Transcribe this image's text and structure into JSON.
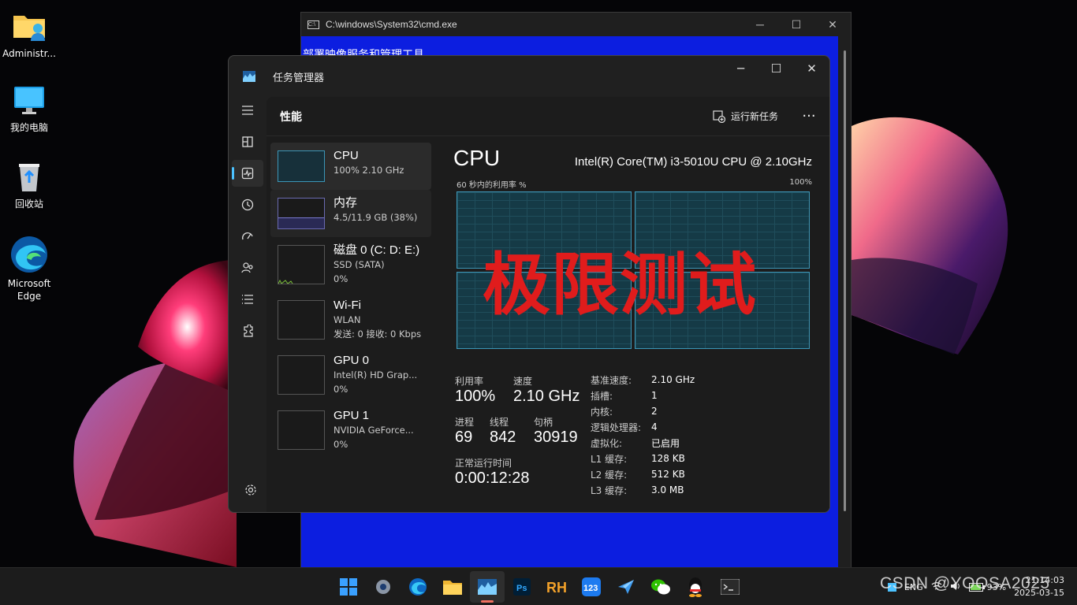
{
  "desktop": {
    "icons": [
      {
        "label": "Administr...",
        "icon": "user-folder-icon"
      },
      {
        "label": "我的电脑",
        "icon": "computer-icon"
      },
      {
        "label": "回收站",
        "icon": "recycle-bin-icon"
      },
      {
        "label": "Microsoft Edge",
        "icon": "edge-icon"
      }
    ]
  },
  "cmd": {
    "title": "C:\\windows\\System32\\cmd.exe",
    "body_text": "部署映像服务和管理工具"
  },
  "taskmgr": {
    "title": "任务管理器",
    "page_title": "性能",
    "run_task_label": "运行新任务",
    "more_label": "···",
    "sidebar": [
      "menu-icon",
      "processes-icon",
      "performance-icon",
      "app-history-icon",
      "startup-icon",
      "users-icon",
      "details-icon",
      "services-icon",
      "settings-icon"
    ],
    "perf_items": [
      {
        "name": "CPU",
        "line1": "100% 2.10 GHz",
        "line2": ""
      },
      {
        "name": "内存",
        "line1": "4.5/11.9 GB (38%)",
        "line2": ""
      },
      {
        "name": "磁盘 0 (C: D: E:)",
        "line1": "SSD (SATA)",
        "line2": "0%"
      },
      {
        "name": "Wi-Fi",
        "line1": "WLAN",
        "line2": "发送: 0 接收: 0 Kbps"
      },
      {
        "name": "GPU 0",
        "line1": "Intel(R) HD Grap...",
        "line2": "0%"
      },
      {
        "name": "GPU 1",
        "line1": "NVIDIA GeForce...",
        "line2": "0%"
      }
    ],
    "detail": {
      "heading": "CPU",
      "model": "Intel(R) Core(TM) i3-5010U CPU @ 2.10GHz",
      "graph_label": "60 秒内的利用率 %",
      "graph_max": "100%",
      "overlay": "极限测试",
      "stats": {
        "util_label": "利用率",
        "util_value": "100%",
        "speed_label": "速度",
        "speed_value": "2.10 GHz",
        "proc_label": "进程",
        "proc_value": "69",
        "thread_label": "线程",
        "thread_value": "842",
        "handle_label": "句柄",
        "handle_value": "30919",
        "uptime_label": "正常运行时间",
        "uptime_value": "0:00:12:28"
      },
      "specs": [
        {
          "k": "基准速度:",
          "v": "2.10 GHz"
        },
        {
          "k": "插槽:",
          "v": "1"
        },
        {
          "k": "内核:",
          "v": "2"
        },
        {
          "k": "逻辑处理器:",
          "v": "4"
        },
        {
          "k": "虚拟化:",
          "v": "已启用"
        },
        {
          "k": "L1 缓存:",
          "v": "128 KB"
        },
        {
          "k": "L2 缓存:",
          "v": "512 KB"
        },
        {
          "k": "L3 缓存:",
          "v": "3.0 MB"
        }
      ]
    }
  },
  "taskbar": {
    "apps": [
      "start-icon",
      "settings-icon",
      "edge-icon",
      "file-explorer-icon",
      "task-manager-icon",
      "photoshop-icon",
      "rh-icon",
      "123-icon",
      "feishu-icon",
      "wechat-icon",
      "qq-icon",
      "terminal-icon"
    ],
    "tray_lang": "ENG",
    "battery": "93%",
    "time": "21:14:03",
    "date": "2025-03-15"
  },
  "watermark": "CSDN @YOOSA2025"
}
